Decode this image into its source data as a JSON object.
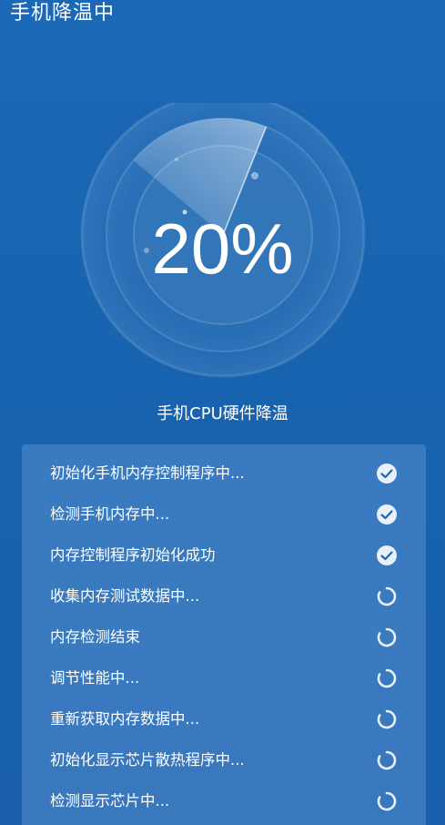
{
  "header": {
    "title": "手机降温中"
  },
  "gauge": {
    "percent_text": "20%",
    "progress": 0.2,
    "subtitle": "手机CPU硬件降温"
  },
  "tasks": [
    {
      "label": "初始化手机内存控制程序中...",
      "status": "done",
      "icon": "check-circle-icon"
    },
    {
      "label": "检测手机内存中...",
      "status": "done",
      "icon": "check-circle-icon"
    },
    {
      "label": "内存控制程序初始化成功",
      "status": "done",
      "icon": "check-circle-icon"
    },
    {
      "label": "收集内存测试数据中...",
      "status": "pending",
      "icon": "loading-spinner-icon"
    },
    {
      "label": "内存检测结束",
      "status": "pending",
      "icon": "loading-spinner-icon"
    },
    {
      "label": "调节性能中...",
      "status": "pending",
      "icon": "loading-spinner-icon"
    },
    {
      "label": "重新获取内存数据中...",
      "status": "pending",
      "icon": "loading-spinner-icon"
    },
    {
      "label": "初始化显示芯片散热程序中...",
      "status": "pending",
      "icon": "loading-spinner-icon"
    },
    {
      "label": "检测显示芯片中...",
      "status": "pending",
      "icon": "loading-spinner-icon"
    }
  ],
  "colors": {
    "background": "#1a63b1",
    "panel": "#4a86c8",
    "icon": "#e8f0fa"
  }
}
